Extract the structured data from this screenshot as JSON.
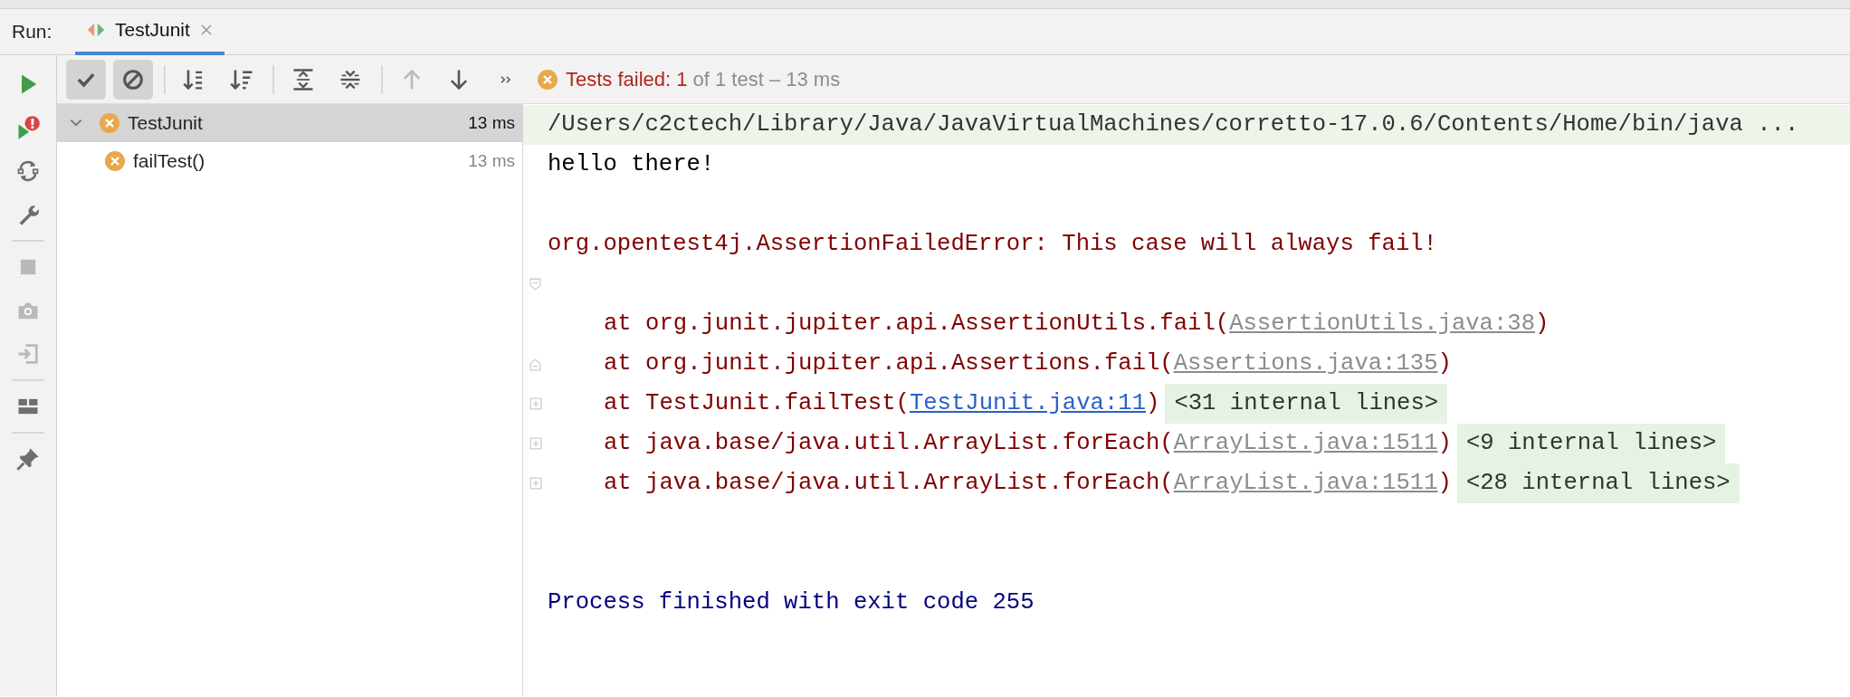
{
  "tab_bar": {
    "label": "Run:",
    "tabs": [
      {
        "title": "TestJunit",
        "selected": true
      }
    ]
  },
  "side_toolbar": [
    {
      "kind": "run",
      "disabled": false
    },
    {
      "kind": "rerun-failed",
      "disabled": false
    },
    {
      "kind": "auto-test",
      "disabled": false
    },
    {
      "kind": "settings",
      "disabled": false
    },
    {
      "kind": "separator"
    },
    {
      "kind": "stop",
      "disabled": true
    },
    {
      "kind": "screenshot",
      "disabled": true
    },
    {
      "kind": "import",
      "disabled": true
    },
    {
      "kind": "separator"
    },
    {
      "kind": "layout",
      "disabled": false
    },
    {
      "kind": "separator"
    },
    {
      "kind": "pin",
      "disabled": false
    }
  ],
  "toolbar": [
    {
      "kind": "show-passed",
      "on": true,
      "disabled": false
    },
    {
      "kind": "show-ignored",
      "on": true,
      "disabled": false
    },
    {
      "kind": "separator"
    },
    {
      "kind": "sort-alpha",
      "on": false,
      "disabled": false
    },
    {
      "kind": "sort-duration",
      "on": false,
      "disabled": false
    },
    {
      "kind": "separator"
    },
    {
      "kind": "expand-all",
      "on": false,
      "disabled": false
    },
    {
      "kind": "collapse-all",
      "on": false,
      "disabled": false
    },
    {
      "kind": "separator"
    },
    {
      "kind": "previous",
      "on": false,
      "disabled": true
    },
    {
      "kind": "next",
      "on": false,
      "disabled": false
    },
    {
      "kind": "more",
      "on": false,
      "disabled": false
    }
  ],
  "status": {
    "kind": "failed",
    "failed_text": "Tests failed: 1",
    "summary": "of 1 test – 13 ms"
  },
  "tree": [
    {
      "name": "TestJunit",
      "time": "13 ms",
      "kind": "failed",
      "selected": true,
      "expanded": true,
      "children": [
        {
          "name": "failTest()",
          "time": "13 ms",
          "kind": "failed",
          "selected": false
        }
      ]
    }
  ],
  "console": {
    "lines": [
      {
        "kind": "command",
        "text": "/Users/c2ctech/Library/Java/JavaVirtualMachines/corretto-17.0.6/Contents/Home/bin/java ..."
      },
      {
        "kind": "stdout",
        "text": "hello there!"
      },
      {
        "kind": "blank"
      },
      {
        "kind": "error",
        "text": "org.opentest4j.AssertionFailedError: This case will always fail!"
      },
      {
        "kind": "blank",
        "gutter": {
          "kind": "fold-start"
        }
      },
      {
        "kind": "frame",
        "text": "at org.junit.jupiter.api.AssertionUtils.fail(",
        "link": {
          "kind": "library",
          "text": "AssertionUtils.java:38"
        },
        "end": ")"
      },
      {
        "kind": "frame",
        "gutter": {
          "kind": "fold-end"
        },
        "text": "at org.junit.jupiter.api.Assertions.fail(",
        "link": {
          "kind": "library",
          "text": "Assertions.java:135"
        },
        "end": ")"
      },
      {
        "kind": "frame",
        "gutter": {
          "kind": "expand"
        },
        "text": "at TestJunit.failTest(",
        "link": {
          "kind": "project",
          "text": "TestJunit.java:11"
        },
        "end": ")",
        "folded": "<31 internal lines>"
      },
      {
        "kind": "frame",
        "gutter": {
          "kind": "expand"
        },
        "text": "at java.base/java.util.ArrayList.forEach(",
        "link": {
          "kind": "library",
          "text": "ArrayList.java:1511"
        },
        "end": ")",
        "folded": "<9 internal lines>"
      },
      {
        "kind": "frame",
        "gutter": {
          "kind": "expand"
        },
        "text": "at java.base/java.util.ArrayList.forEach(",
        "link": {
          "kind": "library",
          "text": "ArrayList.java:1511"
        },
        "end": ")",
        "folded": "<28 internal lines>"
      },
      {
        "kind": "blank"
      },
      {
        "kind": "blank"
      },
      {
        "kind": "exit",
        "text": "Process finished with exit code 255"
      }
    ]
  }
}
